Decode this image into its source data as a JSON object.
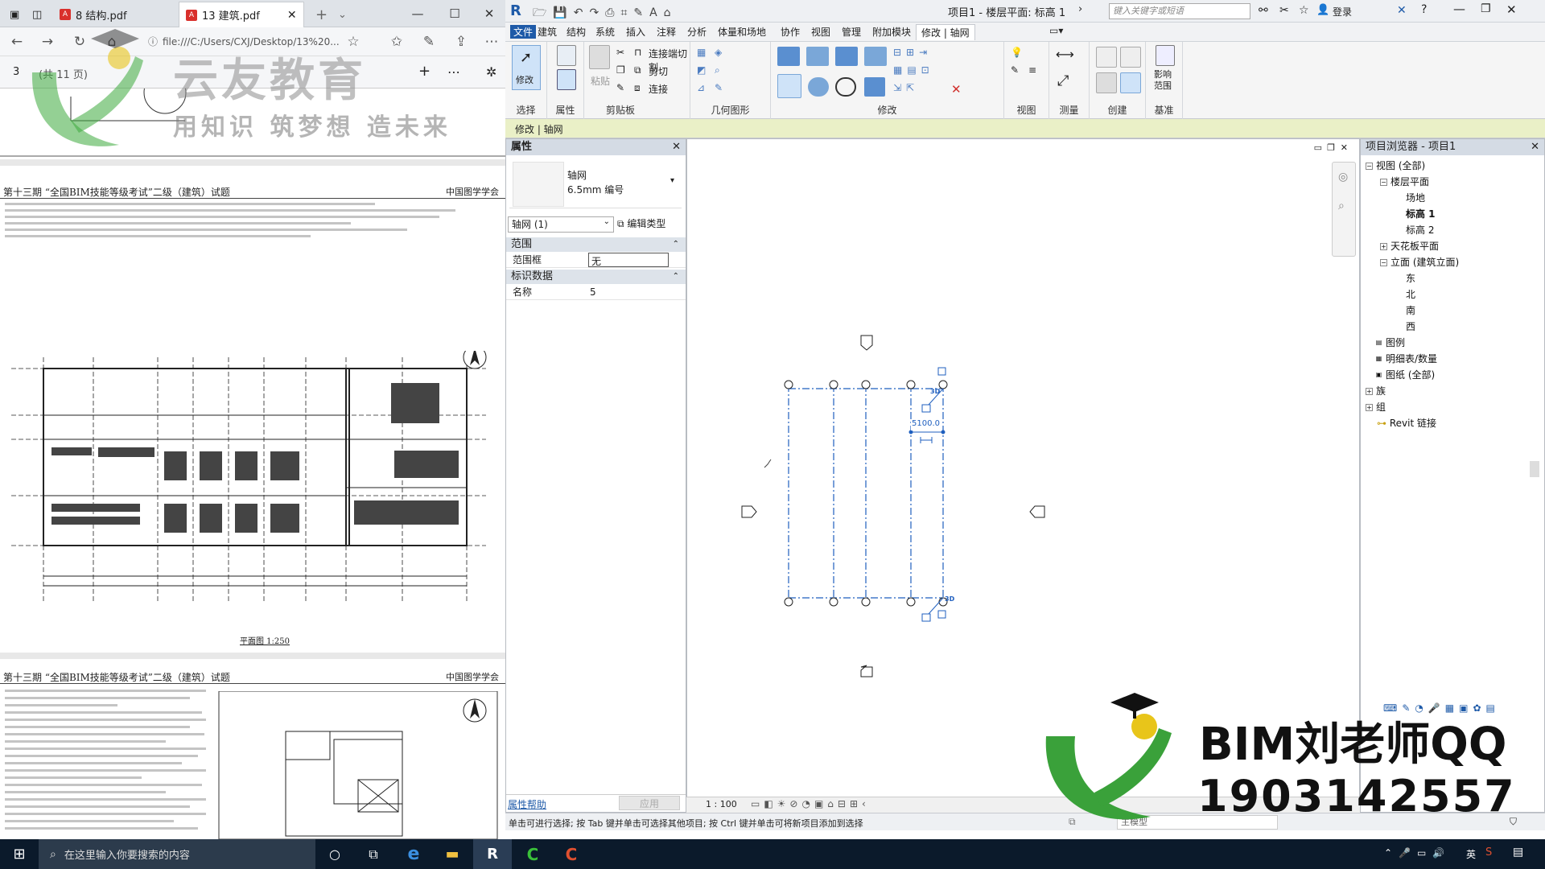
{
  "pdf_viewer": {
    "tabs": [
      {
        "label": "8 结构.pdf",
        "active": false
      },
      {
        "label": "13 建筑.pdf",
        "active": true
      }
    ],
    "address": "file:///C:/Users/CXJ/Desktop/13%20...",
    "page_number": "3",
    "page_total": "(共 11 页)",
    "pages": [
      {
        "header": "第十三期 “全国BIM技能等级考试”二级（建筑）试题",
        "header_right": "中国图学学会"
      },
      {
        "header": "第十三期 “全国BIM技能等级考试”二级（建筑）试题",
        "header_right": "中国图学学会"
      }
    ],
    "plan_caption": "平面图 1:250"
  },
  "watermark": {
    "title": "云友教育",
    "subtitle": "用知识 筑梦想 造未来"
  },
  "revit": {
    "title": "项目1 - 楼层平面: 标高 1",
    "search_placeholder": "键入关键字或短语",
    "login": "登录",
    "ribbon_tabs": [
      {
        "label": "文件",
        "active": false
      },
      {
        "label": "建筑",
        "active": false
      },
      {
        "label": "结构",
        "active": false
      },
      {
        "label": "系统",
        "active": false
      },
      {
        "label": "插入",
        "active": false
      },
      {
        "label": "注释",
        "active": false
      },
      {
        "label": "分析",
        "active": false
      },
      {
        "label": "体量和场地",
        "active": false
      },
      {
        "label": "协作",
        "active": false
      },
      {
        "label": "视图",
        "active": false
      },
      {
        "label": "管理",
        "active": false
      },
      {
        "label": "附加模块",
        "active": false
      },
      {
        "label": "修改 | 轴网",
        "active": true
      }
    ],
    "ribbon_groups": {
      "select": "选择",
      "properties": "属性",
      "clipboard": "剪贴板",
      "geometry": "几何图形",
      "modify": "修改",
      "view": "视图",
      "measure": "测量",
      "create": "创建",
      "datum": "基准"
    },
    "ribbon_buttons": {
      "modify": "修改",
      "paste": "粘贴",
      "join_cut": "连接端切割",
      "cut": "剪切",
      "join": "连接",
      "scope_box": "影响 范围"
    },
    "context_bar": "修改 | 轴网",
    "properties": {
      "title": "属性",
      "type_name": "轴网",
      "type_sub": "6.5mm 编号",
      "selector": "轴网 (1)",
      "edit_type": "编辑类型",
      "section_extents": "范围",
      "scope_box_label": "范围框",
      "scope_box_value": "无",
      "section_identity": "标识数据",
      "name_label": "名称",
      "name_value": "5",
      "help": "属性帮助",
      "apply": "应用"
    },
    "dimension": "5100.0",
    "scale": "1 : 100",
    "browser": {
      "title": "项目浏览器 - 项目1",
      "nodes": [
        {
          "label": "视图 (全部)",
          "level": 0
        },
        {
          "label": "楼层平面",
          "level": 1
        },
        {
          "label": "场地",
          "level": 2
        },
        {
          "label": "标高 1",
          "level": 2
        },
        {
          "label": "标高 2",
          "level": 2
        },
        {
          "label": "天花板平面",
          "level": 1
        },
        {
          "label": "立面 (建筑立面)",
          "level": 1
        },
        {
          "label": "东",
          "level": 2
        },
        {
          "label": "北",
          "level": 2
        },
        {
          "label": "南",
          "level": 2
        },
        {
          "label": "西",
          "level": 2
        },
        {
          "label": "图例",
          "level": 0
        },
        {
          "label": "明细表/数量",
          "level": 0
        },
        {
          "label": "图纸 (全部)",
          "level": 0
        },
        {
          "label": "族",
          "level": 0
        },
        {
          "label": "组",
          "level": 0
        },
        {
          "label": "Revit 链接",
          "level": 0
        }
      ]
    },
    "status_text": "单击可进行选择; 按 Tab 键并单击可选择其他项目; 按 Ctrl 键并单击可将新项目添加到选择",
    "workset": "主模型"
  },
  "branding": {
    "line1": "BIM刘老师QQ",
    "line2": "1903142557"
  },
  "taskbar": {
    "search_placeholder": "在这里输入你要搜索的内容",
    "ime": "英"
  },
  "colors": {
    "revit_accent": "#1e5aa8",
    "context_bar": "#eaf0c7",
    "grid_select": "#1f5fbf",
    "taskbar": "#0b1a2b",
    "logo_green": "#3aa13a",
    "logo_yellow": "#e8c51a"
  }
}
